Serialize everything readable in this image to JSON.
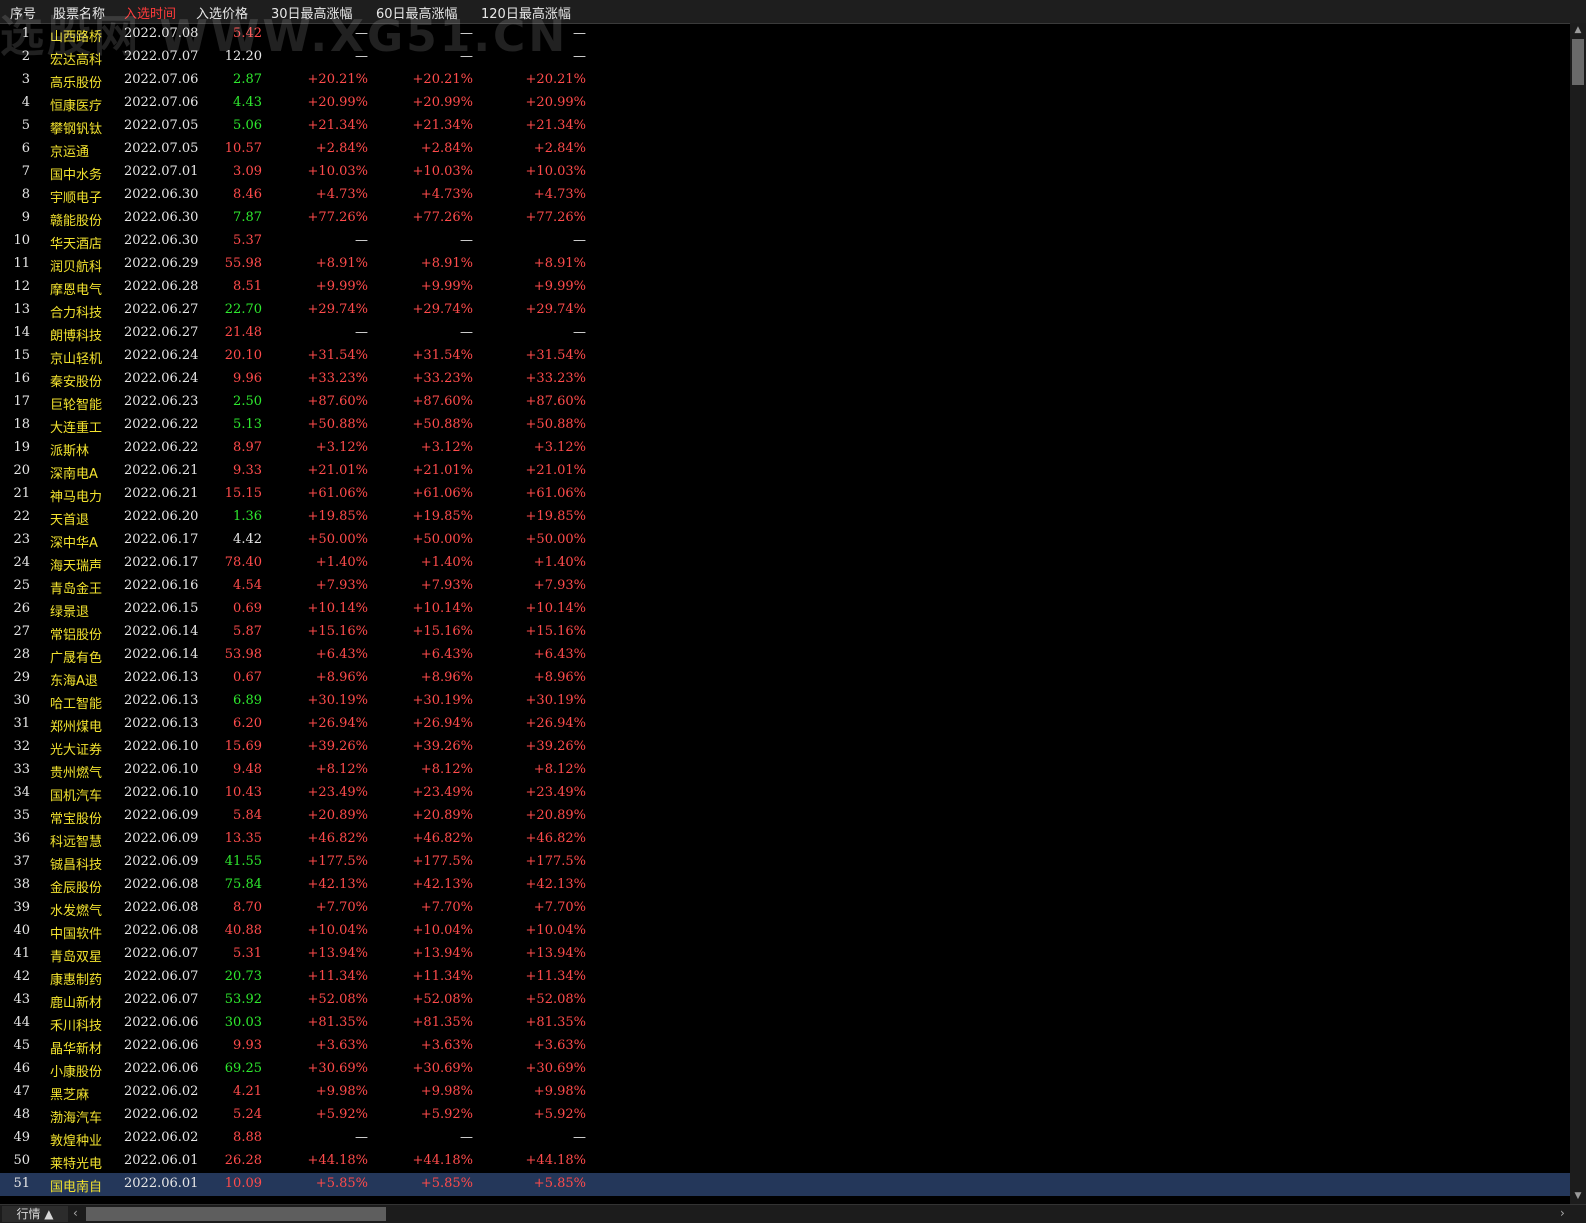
{
  "watermark": "选股网 WWW.XG51.CN",
  "columns": {
    "index": "序号",
    "name": "股票名称",
    "date": "入选时间",
    "price": "入选价格",
    "gain30": "30日最高涨幅",
    "gain60": "60日最高涨幅",
    "gain120": "120日最高涨幅"
  },
  "colors": {
    "red": "#ff4b4b",
    "green": "#2ee82e",
    "white": "#e6e6e6",
    "name_yellow": "#f2e22e",
    "selected_row": "#24375a"
  },
  "rows": [
    {
      "i": "1",
      "name": "山西路桥",
      "date": "2022.07.08",
      "price": "5.42",
      "pc": "red",
      "g30": "—",
      "g60": "—",
      "g120": "—"
    },
    {
      "i": "2",
      "name": "宏达高科",
      "date": "2022.07.07",
      "price": "12.20",
      "pc": "white",
      "g30": "—",
      "g60": "—",
      "g120": "—"
    },
    {
      "i": "3",
      "name": "高乐股份",
      "date": "2022.07.06",
      "price": "2.87",
      "pc": "green",
      "g30": "+20.21%",
      "g60": "+20.21%",
      "g120": "+20.21%"
    },
    {
      "i": "4",
      "name": "恒康医疗",
      "date": "2022.07.06",
      "price": "4.43",
      "pc": "green",
      "g30": "+20.99%",
      "g60": "+20.99%",
      "g120": "+20.99%"
    },
    {
      "i": "5",
      "name": "攀钢钒钛",
      "date": "2022.07.05",
      "price": "5.06",
      "pc": "green",
      "g30": "+21.34%",
      "g60": "+21.34%",
      "g120": "+21.34%"
    },
    {
      "i": "6",
      "name": "京运通",
      "date": "2022.07.05",
      "price": "10.57",
      "pc": "red",
      "g30": "+2.84%",
      "g60": "+2.84%",
      "g120": "+2.84%"
    },
    {
      "i": "7",
      "name": "国中水务",
      "date": "2022.07.01",
      "price": "3.09",
      "pc": "red",
      "g30": "+10.03%",
      "g60": "+10.03%",
      "g120": "+10.03%"
    },
    {
      "i": "8",
      "name": "宇顺电子",
      "date": "2022.06.30",
      "price": "8.46",
      "pc": "red",
      "g30": "+4.73%",
      "g60": "+4.73%",
      "g120": "+4.73%"
    },
    {
      "i": "9",
      "name": "赣能股份",
      "date": "2022.06.30",
      "price": "7.87",
      "pc": "green",
      "g30": "+77.26%",
      "g60": "+77.26%",
      "g120": "+77.26%"
    },
    {
      "i": "10",
      "name": "华天酒店",
      "date": "2022.06.30",
      "price": "5.37",
      "pc": "red",
      "g30": "—",
      "g60": "—",
      "g120": "—"
    },
    {
      "i": "11",
      "name": "润贝航科",
      "date": "2022.06.29",
      "price": "55.98",
      "pc": "red",
      "g30": "+8.91%",
      "g60": "+8.91%",
      "g120": "+8.91%"
    },
    {
      "i": "12",
      "name": "摩恩电气",
      "date": "2022.06.28",
      "price": "8.51",
      "pc": "red",
      "g30": "+9.99%",
      "g60": "+9.99%",
      "g120": "+9.99%"
    },
    {
      "i": "13",
      "name": "合力科技",
      "date": "2022.06.27",
      "price": "22.70",
      "pc": "green",
      "g30": "+29.74%",
      "g60": "+29.74%",
      "g120": "+29.74%"
    },
    {
      "i": "14",
      "name": "朗博科技",
      "date": "2022.06.27",
      "price": "21.48",
      "pc": "red",
      "g30": "—",
      "g60": "—",
      "g120": "—"
    },
    {
      "i": "15",
      "name": "京山轻机",
      "date": "2022.06.24",
      "price": "20.10",
      "pc": "red",
      "g30": "+31.54%",
      "g60": "+31.54%",
      "g120": "+31.54%"
    },
    {
      "i": "16",
      "name": "秦安股份",
      "date": "2022.06.24",
      "price": "9.96",
      "pc": "red",
      "g30": "+33.23%",
      "g60": "+33.23%",
      "g120": "+33.23%"
    },
    {
      "i": "17",
      "name": "巨轮智能",
      "date": "2022.06.23",
      "price": "2.50",
      "pc": "green",
      "g30": "+87.60%",
      "g60": "+87.60%",
      "g120": "+87.60%"
    },
    {
      "i": "18",
      "name": "大连重工",
      "date": "2022.06.22",
      "price": "5.13",
      "pc": "green",
      "g30": "+50.88%",
      "g60": "+50.88%",
      "g120": "+50.88%"
    },
    {
      "i": "19",
      "name": "派斯林",
      "date": "2022.06.22",
      "price": "8.97",
      "pc": "red",
      "g30": "+3.12%",
      "g60": "+3.12%",
      "g120": "+3.12%"
    },
    {
      "i": "20",
      "name": "深南电A",
      "date": "2022.06.21",
      "price": "9.33",
      "pc": "red",
      "g30": "+21.01%",
      "g60": "+21.01%",
      "g120": "+21.01%"
    },
    {
      "i": "21",
      "name": "神马电力",
      "date": "2022.06.21",
      "price": "15.15",
      "pc": "red",
      "g30": "+61.06%",
      "g60": "+61.06%",
      "g120": "+61.06%"
    },
    {
      "i": "22",
      "name": "天首退",
      "date": "2022.06.20",
      "price": "1.36",
      "pc": "green",
      "g30": "+19.85%",
      "g60": "+19.85%",
      "g120": "+19.85%"
    },
    {
      "i": "23",
      "name": "深中华A",
      "date": "2022.06.17",
      "price": "4.42",
      "pc": "white",
      "g30": "+50.00%",
      "g60": "+50.00%",
      "g120": "+50.00%"
    },
    {
      "i": "24",
      "name": "海天瑞声",
      "date": "2022.06.17",
      "price": "78.40",
      "pc": "red",
      "g30": "+1.40%",
      "g60": "+1.40%",
      "g120": "+1.40%"
    },
    {
      "i": "25",
      "name": "青岛金王",
      "date": "2022.06.16",
      "price": "4.54",
      "pc": "red",
      "g30": "+7.93%",
      "g60": "+7.93%",
      "g120": "+7.93%"
    },
    {
      "i": "26",
      "name": "绿景退",
      "date": "2022.06.15",
      "price": "0.69",
      "pc": "red",
      "g30": "+10.14%",
      "g60": "+10.14%",
      "g120": "+10.14%"
    },
    {
      "i": "27",
      "name": "常铝股份",
      "date": "2022.06.14",
      "price": "5.87",
      "pc": "red",
      "g30": "+15.16%",
      "g60": "+15.16%",
      "g120": "+15.16%"
    },
    {
      "i": "28",
      "name": "广晟有色",
      "date": "2022.06.14",
      "price": "53.98",
      "pc": "red",
      "g30": "+6.43%",
      "g60": "+6.43%",
      "g120": "+6.43%"
    },
    {
      "i": "29",
      "name": "东海A退",
      "date": "2022.06.13",
      "price": "0.67",
      "pc": "red",
      "g30": "+8.96%",
      "g60": "+8.96%",
      "g120": "+8.96%"
    },
    {
      "i": "30",
      "name": "哈工智能",
      "date": "2022.06.13",
      "price": "6.89",
      "pc": "green",
      "g30": "+30.19%",
      "g60": "+30.19%",
      "g120": "+30.19%"
    },
    {
      "i": "31",
      "name": "郑州煤电",
      "date": "2022.06.13",
      "price": "6.20",
      "pc": "red",
      "g30": "+26.94%",
      "g60": "+26.94%",
      "g120": "+26.94%"
    },
    {
      "i": "32",
      "name": "光大证券",
      "date": "2022.06.10",
      "price": "15.69",
      "pc": "red",
      "g30": "+39.26%",
      "g60": "+39.26%",
      "g120": "+39.26%"
    },
    {
      "i": "33",
      "name": "贵州燃气",
      "date": "2022.06.10",
      "price": "9.48",
      "pc": "red",
      "g30": "+8.12%",
      "g60": "+8.12%",
      "g120": "+8.12%"
    },
    {
      "i": "34",
      "name": "国机汽车",
      "date": "2022.06.10",
      "price": "10.43",
      "pc": "red",
      "g30": "+23.49%",
      "g60": "+23.49%",
      "g120": "+23.49%"
    },
    {
      "i": "35",
      "name": "常宝股份",
      "date": "2022.06.09",
      "price": "5.84",
      "pc": "red",
      "g30": "+20.89%",
      "g60": "+20.89%",
      "g120": "+20.89%"
    },
    {
      "i": "36",
      "name": "科远智慧",
      "date": "2022.06.09",
      "price": "13.35",
      "pc": "red",
      "g30": "+46.82%",
      "g60": "+46.82%",
      "g120": "+46.82%"
    },
    {
      "i": "37",
      "name": "铖昌科技",
      "date": "2022.06.09",
      "price": "41.55",
      "pc": "green",
      "g30": "+177.5%",
      "g60": "+177.5%",
      "g120": "+177.5%"
    },
    {
      "i": "38",
      "name": "金辰股份",
      "date": "2022.06.08",
      "price": "75.84",
      "pc": "green",
      "g30": "+42.13%",
      "g60": "+42.13%",
      "g120": "+42.13%"
    },
    {
      "i": "39",
      "name": "水发燃气",
      "date": "2022.06.08",
      "price": "8.70",
      "pc": "red",
      "g30": "+7.70%",
      "g60": "+7.70%",
      "g120": "+7.70%"
    },
    {
      "i": "40",
      "name": "中国软件",
      "date": "2022.06.08",
      "price": "40.88",
      "pc": "red",
      "g30": "+10.04%",
      "g60": "+10.04%",
      "g120": "+10.04%"
    },
    {
      "i": "41",
      "name": "青岛双星",
      "date": "2022.06.07",
      "price": "5.31",
      "pc": "red",
      "g30": "+13.94%",
      "g60": "+13.94%",
      "g120": "+13.94%"
    },
    {
      "i": "42",
      "name": "康惠制药",
      "date": "2022.06.07",
      "price": "20.73",
      "pc": "green",
      "g30": "+11.34%",
      "g60": "+11.34%",
      "g120": "+11.34%"
    },
    {
      "i": "43",
      "name": "鹿山新材",
      "date": "2022.06.07",
      "price": "53.92",
      "pc": "green",
      "g30": "+52.08%",
      "g60": "+52.08%",
      "g120": "+52.08%"
    },
    {
      "i": "44",
      "name": "禾川科技",
      "date": "2022.06.06",
      "price": "30.03",
      "pc": "green",
      "g30": "+81.35%",
      "g60": "+81.35%",
      "g120": "+81.35%"
    },
    {
      "i": "45",
      "name": "晶华新材",
      "date": "2022.06.06",
      "price": "9.93",
      "pc": "red",
      "g30": "+3.63%",
      "g60": "+3.63%",
      "g120": "+3.63%"
    },
    {
      "i": "46",
      "name": "小康股份",
      "date": "2022.06.06",
      "price": "69.25",
      "pc": "green",
      "g30": "+30.69%",
      "g60": "+30.69%",
      "g120": "+30.69%"
    },
    {
      "i": "47",
      "name": "黑芝麻",
      "date": "2022.06.02",
      "price": "4.21",
      "pc": "red",
      "g30": "+9.98%",
      "g60": "+9.98%",
      "g120": "+9.98%"
    },
    {
      "i": "48",
      "name": "渤海汽车",
      "date": "2022.06.02",
      "price": "5.24",
      "pc": "red",
      "g30": "+5.92%",
      "g60": "+5.92%",
      "g120": "+5.92%"
    },
    {
      "i": "49",
      "name": "敦煌种业",
      "date": "2022.06.02",
      "price": "8.88",
      "pc": "red",
      "g30": "—",
      "g60": "—",
      "g120": "—"
    },
    {
      "i": "50",
      "name": "莱特光电",
      "date": "2022.06.01",
      "price": "26.28",
      "pc": "red",
      "g30": "+44.18%",
      "g60": "+44.18%",
      "g120": "+44.18%"
    },
    {
      "i": "51",
      "name": "国电南自",
      "date": "2022.06.01",
      "price": "10.09",
      "pc": "red",
      "g30": "+5.85%",
      "g60": "+5.85%",
      "g120": "+5.85%",
      "selected": true
    }
  ],
  "bottom": {
    "tab_label": "行情 ▲",
    "scroll_left": "‹",
    "scroll_right": "›"
  },
  "scrollbar": {
    "up": "▲",
    "down": "▼"
  }
}
